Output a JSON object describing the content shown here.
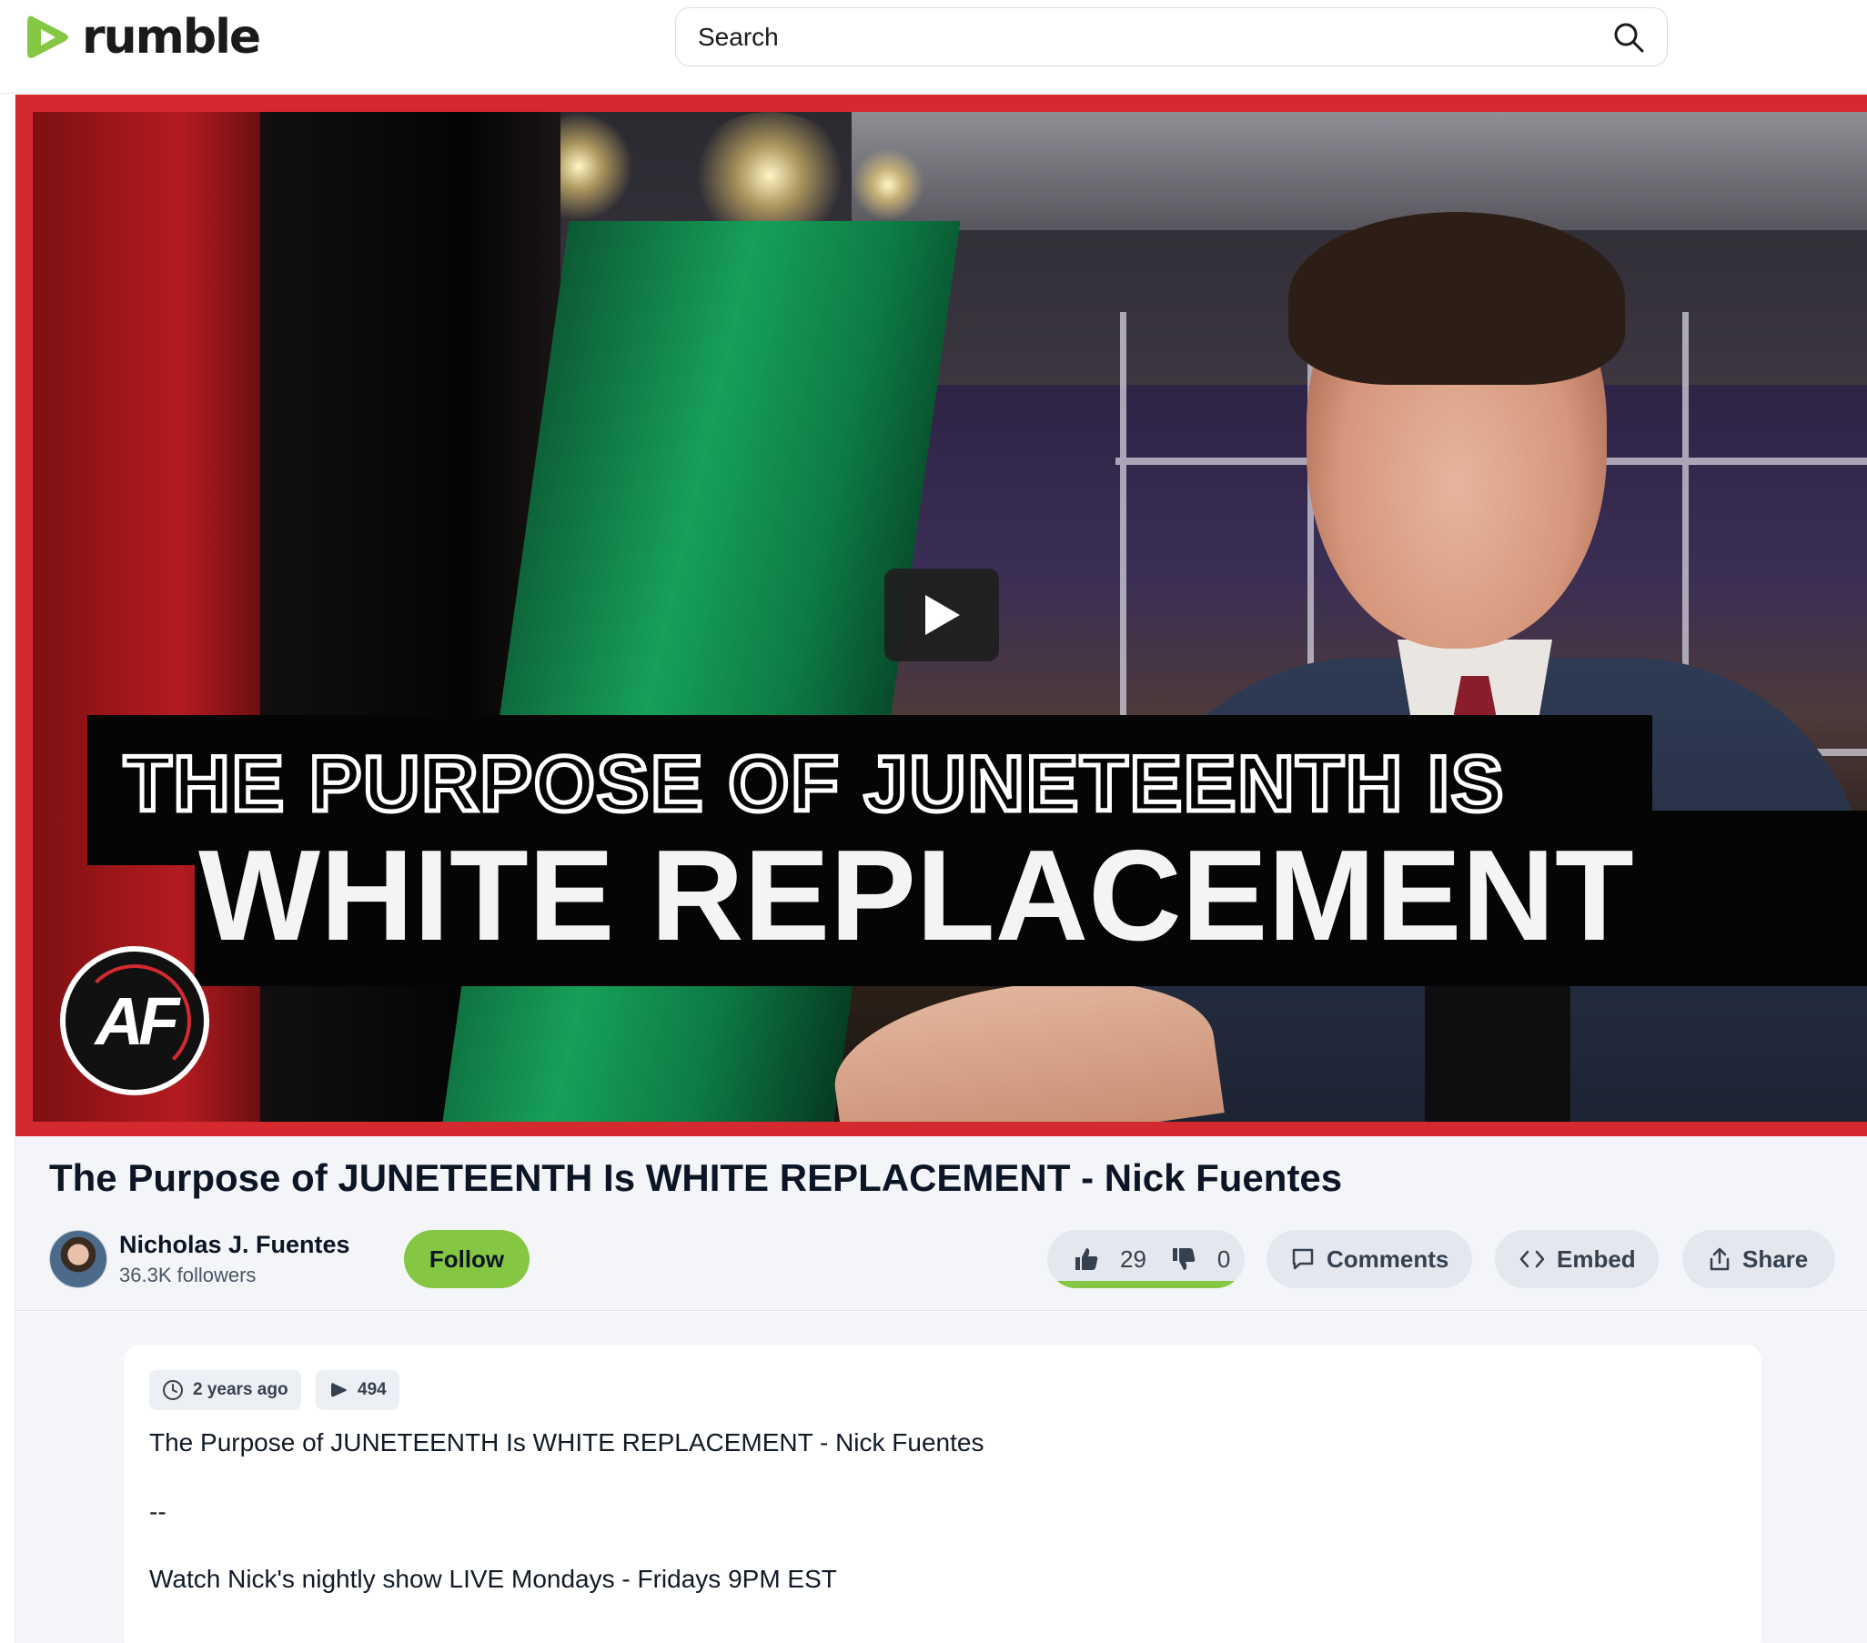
{
  "header": {
    "logo_text": "rumble",
    "brand_color": "#85c742",
    "search_placeholder": "Search"
  },
  "video": {
    "thumbnail_text_line1": "THE PURPOSE OF JUNETEENTH IS",
    "thumbnail_text_line2": "WHITE REPLACEMENT",
    "badge_text": "AF",
    "border_color": "#d42a2f"
  },
  "info": {
    "title": "The Purpose of JUNETEENTH Is WHITE REPLACEMENT - Nick Fuentes",
    "channel_name": "Nicholas J. Fuentes",
    "followers": "36.3K followers",
    "follow_label": "Follow",
    "likes": "29",
    "dislikes": "0",
    "comments_label": "Comments",
    "embed_label": "Embed",
    "share_label": "Share"
  },
  "description": {
    "posted": "2 years ago",
    "views": "494",
    "lines": [
      "The Purpose of JUNETEENTH Is WHITE REPLACEMENT - Nick Fuentes",
      "--",
      "Watch Nick's nightly show LIVE Mondays - Fridays 9PM EST"
    ]
  }
}
